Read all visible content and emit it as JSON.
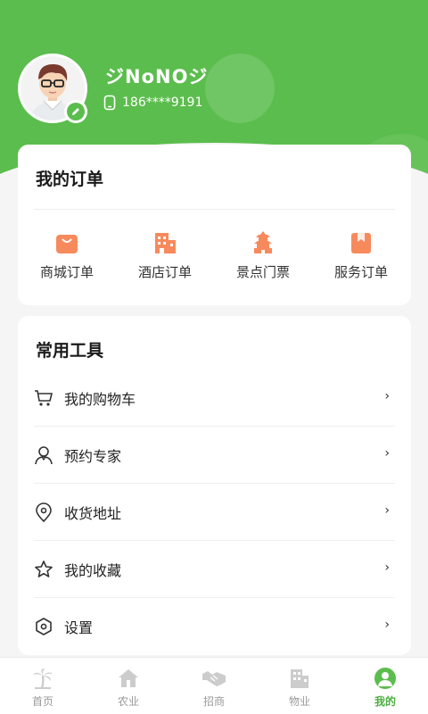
{
  "profile": {
    "username": "ジNoNOジ",
    "phone": "186****9191",
    "avatar_icon": "avatar-cartoon-man",
    "edit_icon": "pencil-icon"
  },
  "orders": {
    "title": "我的订单",
    "items": [
      {
        "label": "商城订单",
        "icon": "shopping-bag-icon"
      },
      {
        "label": "酒店订单",
        "icon": "hotel-icon"
      },
      {
        "label": "景点门票",
        "icon": "pagoda-icon"
      },
      {
        "label": "服务订单",
        "icon": "bookmark-icon"
      }
    ]
  },
  "tools": {
    "title": "常用工具",
    "items": [
      {
        "label": "我的购物车",
        "icon": "cart-icon"
      },
      {
        "label": "预约专家",
        "icon": "expert-icon"
      },
      {
        "label": "收货地址",
        "icon": "location-icon"
      },
      {
        "label": "我的收藏",
        "icon": "star-icon"
      },
      {
        "label": "设置",
        "icon": "settings-icon"
      }
    ],
    "chevron": "›"
  },
  "tabbar": {
    "items": [
      {
        "label": "首页",
        "icon": "palm-tree-icon"
      },
      {
        "label": "农业",
        "icon": "house-icon"
      },
      {
        "label": "招商",
        "icon": "handshake-icon"
      },
      {
        "label": "物业",
        "icon": "building-icon"
      },
      {
        "label": "我的",
        "icon": "person-icon",
        "active": true
      }
    ]
  },
  "colors": {
    "brand_green": "#5bbd4d",
    "order_icon_orange": "#f78a5c",
    "inactive_tab": "#cccccc"
  }
}
